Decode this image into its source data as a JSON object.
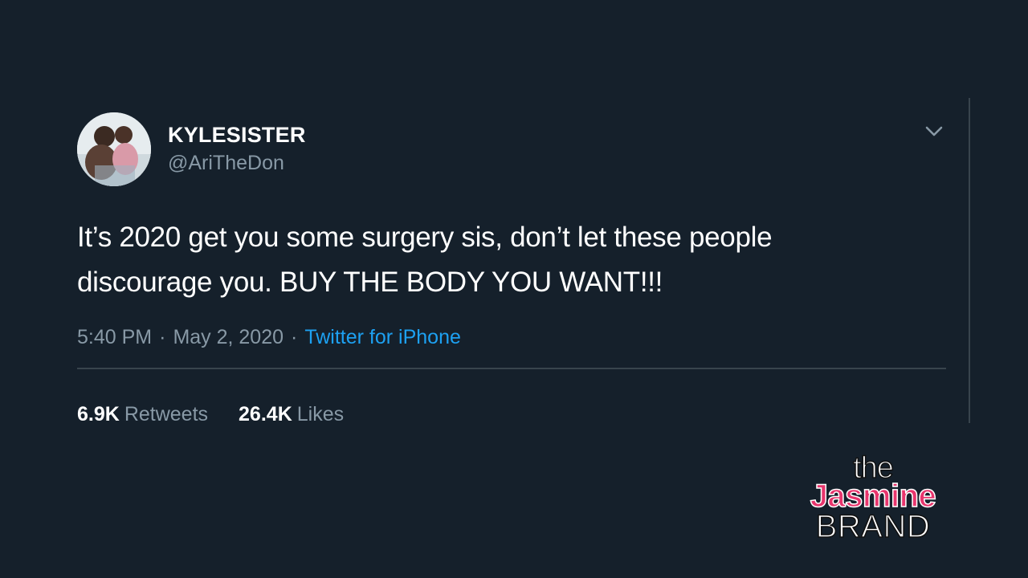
{
  "tweet": {
    "display_name": "KYLESISTER",
    "handle": "@AriTheDon",
    "text_lines": [
      "It’s 2020 get you some surgery sis, don’t let these people",
      "discourage you. BUY THE BODY YOU WANT!!!"
    ],
    "time": "5:40 PM",
    "separator": "·",
    "date": "May 2, 2020",
    "source": "Twitter for iPhone",
    "retweets_count": "6.9K",
    "retweets_label": "Retweets",
    "likes_count": "26.4K",
    "likes_label": "Likes",
    "menu_icon": "chevron-down-icon"
  },
  "watermark": {
    "line1": "the",
    "line2": "Jasmine",
    "line3": "BRAND"
  },
  "colors": {
    "background": "#15202b",
    "primary_text": "#ffffff",
    "secondary_text": "#8899a6",
    "link": "#1da1f2",
    "divider": "#38444d",
    "watermark_accent": "#e8356d"
  }
}
